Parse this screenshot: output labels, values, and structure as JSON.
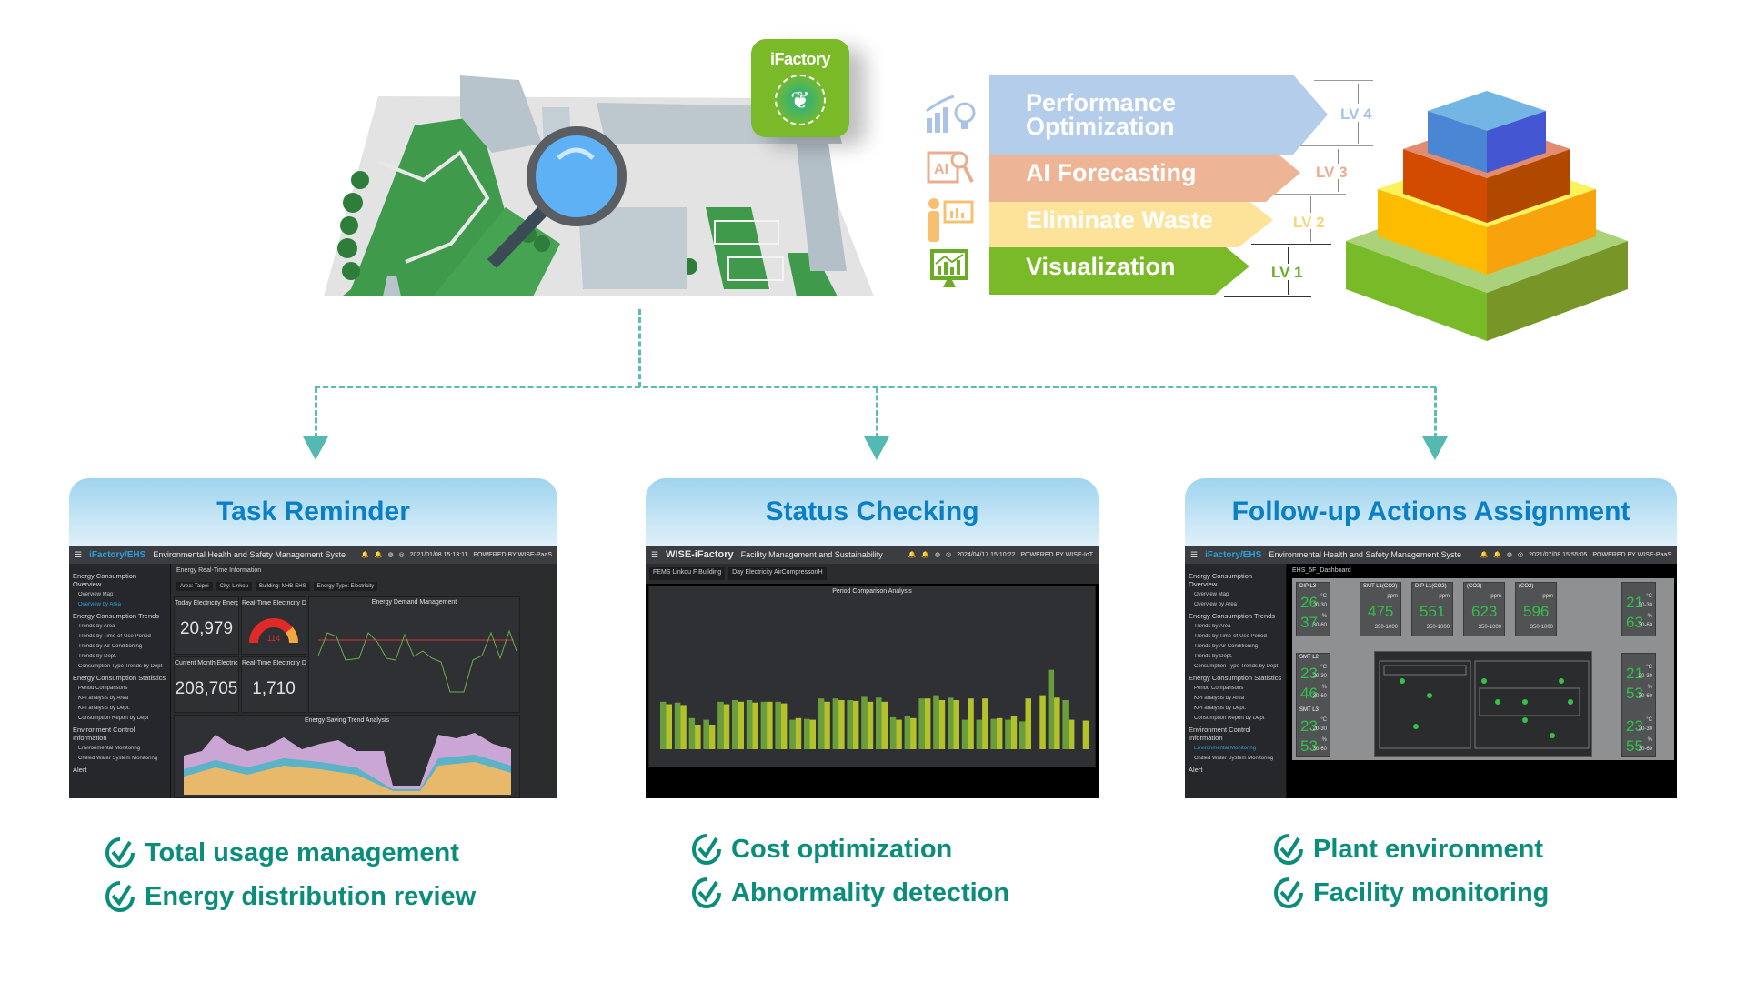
{
  "badge": {
    "label": "iFactory",
    "icon": "recycle-leaf-icon"
  },
  "levels": [
    {
      "id": "lv4",
      "label": "Performance Optimization",
      "line1": "Performance",
      "line2": "Optimization",
      "tag": "LV 4",
      "icon": "chart-lightbulb-icon",
      "color": "#b4cdeb",
      "tag_color": "#a9c3e6"
    },
    {
      "id": "lv3",
      "label": "AI Forecasting",
      "tag": "LV 3",
      "icon": "ai-chip-search-icon",
      "color": "#edb596",
      "tag_color": "#e8ae8e"
    },
    {
      "id": "lv2",
      "label": "Eliminate Waste",
      "tag": "LV 2",
      "icon": "presenter-chart-icon",
      "color": "#fde39a",
      "tag_color": "#f7d67a"
    },
    {
      "id": "lv1",
      "label": "Visualization",
      "tag": "LV 1",
      "icon": "monitor-chart-icon",
      "color": "#7aba28",
      "tag_color": "#6aac24"
    }
  ],
  "pyramid": {
    "tiers": [
      {
        "name": "top",
        "top": "#73b5e3",
        "left": "#4a86d3",
        "right": "#4556d3"
      },
      {
        "name": "upper",
        "top": "#e28b6f",
        "left": "#d14c00",
        "right": "#b04800"
      },
      {
        "name": "middle",
        "top": "#fbf15a",
        "left": "#fdbc00",
        "right": "#f8a30e"
      },
      {
        "name": "base",
        "top": "#a9d27a",
        "left": "#79ba28",
        "right": "#789528"
      }
    ]
  },
  "panels": [
    {
      "title": "Task Reminder",
      "app": {
        "brand": "iFactory/EHS",
        "title": "Environmental Health and Safety Management Syste",
        "datetime": "2021/01/08 15:13:11",
        "powered": "POWERED BY WISE-PaaS",
        "breadcrumb": "Energy Real-Time Information",
        "filters": [
          "Area: Taipei",
          "City: Linkou",
          "Building: NHB-EHS",
          "Energy Type: Electricity"
        ],
        "tiles": [
          {
            "title": "Today Electricity Energy",
            "value": "20,979"
          },
          {
            "title": "Real-Time Electricity Dema...",
            "value": "114"
          },
          {
            "title": "Current Month Electricity ...",
            "value": "208,705"
          },
          {
            "title": "Real-Time Electricity Dem...",
            "value": "1,710"
          }
        ],
        "charts": [
          "Energy Demand Management",
          "Energy Saving Trend Analysis"
        ]
      },
      "checks": [
        "Total usage management",
        "Energy distribution review"
      ]
    },
    {
      "title": "Status Checking",
      "app": {
        "brand": "WISE-iFactory",
        "title": "Facility Management and Sustainability",
        "datetime": "2024/04/17 15:10:22",
        "powered": "POWERED BY WISE-IoT",
        "filters": [
          "FEMS Linkou F Building",
          "Day Electricity AirCompressor/H"
        ],
        "charts": [
          "Period Comparison Analysis"
        ]
      },
      "checks": [
        "Cost optimization",
        "Abnormality detection"
      ]
    },
    {
      "title": "Follow-up Actions Assignment",
      "app": {
        "brand": "iFactory/EHS",
        "title": "Environmental Health and Safety Management Syste",
        "datetime": "2021/07/08 15:55:05",
        "powered": "POWERED BY WISE-PaaS",
        "breadcrumb": "EHS_5F_Dashboard",
        "sensors": [
          {
            "name": "DIP L3",
            "v1": "26",
            "u1": "°C",
            "r1": "20-30",
            "v2": "37",
            "u2": "%",
            "r2": "30-60"
          },
          {
            "name": "SMT L1(CO2)",
            "v1": "475",
            "u1": "ppm",
            "r1": "350-1000"
          },
          {
            "name": "DIP L1(CO2)",
            "v1": "551",
            "u1": "ppm",
            "r1": "350-1000"
          },
          {
            "name": "(CO2)",
            "v1": "623",
            "u1": "ppm",
            "r1": "350-1000"
          },
          {
            "name": "(CO2)",
            "v1": "596",
            "u1": "ppm",
            "r1": "350-1000"
          },
          {
            "name": "",
            "v1": "21",
            "u1": "°C",
            "r1": "20-30",
            "v2": "63",
            "u2": "%",
            "r2": "30-60"
          },
          {
            "name": "SMT L2",
            "v1": "23",
            "u1": "°C",
            "r1": "20-30",
            "v2": "46",
            "u2": "%",
            "r2": "30-60"
          },
          {
            "name": "",
            "v1": "21",
            "u1": "°C",
            "r1": "20-30",
            "v2": "53",
            "u2": "%",
            "r2": "30-60"
          },
          {
            "name": "SMT L3",
            "v1": "23",
            "u1": "°C",
            "r1": "20-30",
            "v2": "53",
            "u2": "%",
            "r2": "30-60"
          },
          {
            "name": "",
            "v1": "23",
            "u1": "°C",
            "r1": "20-30",
            "v2": "55",
            "u2": "%",
            "r2": "30-60"
          }
        ]
      },
      "checks": [
        "Plant environment",
        "Facility monitoring"
      ]
    }
  ],
  "sidebar": {
    "sections": [
      {
        "label": "Energy Consumption Overview",
        "items": [
          "Overview Map",
          "Overview by Area"
        ]
      },
      {
        "label": "Energy Consumption Trends",
        "items": [
          "Trends by Area",
          "Trends by Time-of-Use Period",
          "Trends by Air Conditioning",
          "Trends by Dept.",
          "Consumption Type Trends by Dept"
        ]
      },
      {
        "label": "Energy Consumption Statistics",
        "items": [
          "Period Comparisons",
          "KPI analysis by Area",
          "KPI analysis by Dept.",
          "Consumption Report by Dept"
        ]
      },
      {
        "label": "Environment Control Information",
        "items": [
          "Environmental Monitoring",
          "Chilled Water System Monitoring"
        ]
      },
      {
        "label": "Alert",
        "items": []
      }
    ]
  },
  "colors": {
    "connector": "#5bbcb5",
    "panel_title": "#0b7fc3",
    "check": "#0a8d7b"
  }
}
